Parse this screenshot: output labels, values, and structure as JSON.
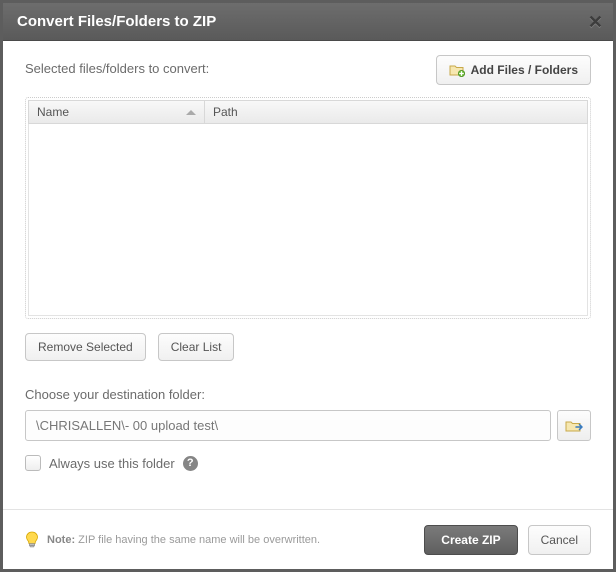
{
  "title": "Convert Files/Folders to ZIP",
  "selected_label": "Selected files/folders to convert:",
  "add_button": "Add Files / Folders",
  "columns": {
    "name": "Name",
    "path": "Path"
  },
  "rows": [],
  "remove_button": "Remove Selected",
  "clear_button": "Clear List",
  "dest_label": "Choose your destination folder:",
  "dest_value": "\\CHRISALLEN\\- 00 upload test\\",
  "always_label": "Always use this folder",
  "note_label": "Note:",
  "note_text": "ZIP file having the same name will be overwritten.",
  "create_button": "Create ZIP",
  "cancel_button": "Cancel"
}
